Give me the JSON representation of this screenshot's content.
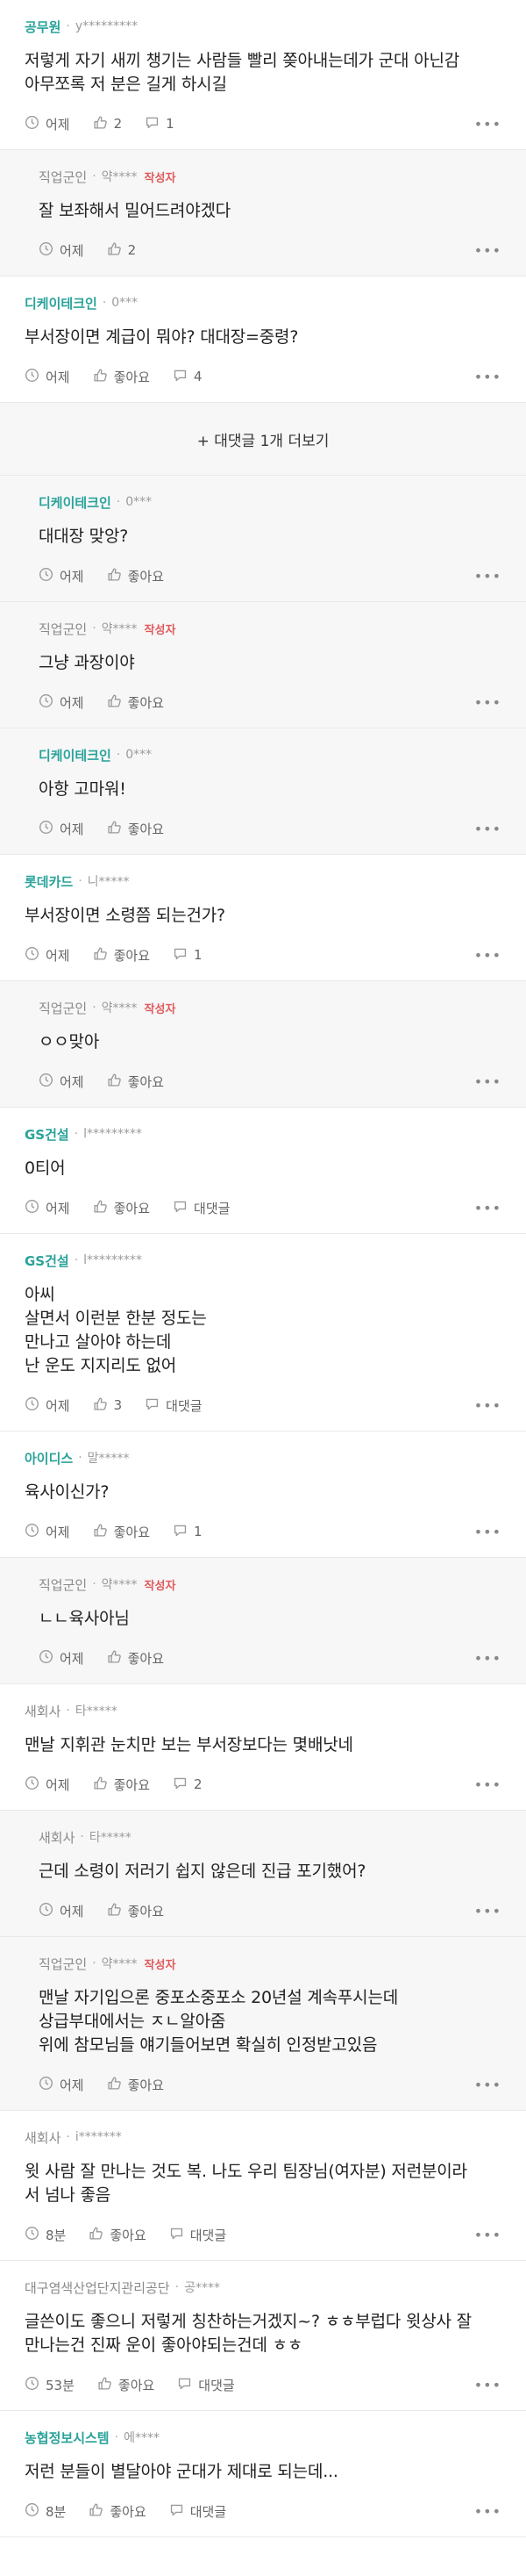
{
  "comments": [
    {
      "id": "c1",
      "reply": false,
      "company": "공무원",
      "company_style": "teal",
      "nick": "y*********",
      "author_badge": "",
      "text": "저렇게 자기 새끼 챙기는 사람들 빨리 쫒아내는데가 군대 아닌감\n아무쪼록 저 분은 길게 하시길",
      "time": "어제",
      "likes": "2",
      "replies": "1"
    },
    {
      "id": "c2",
      "reply": true,
      "company": "직업군인",
      "company_style": "gray",
      "nick": "약****",
      "author_badge": "작성자",
      "text": "잘 보좌해서 밀어드려야겠다",
      "time": "어제",
      "likes": "2",
      "replies": null
    },
    {
      "id": "c3",
      "reply": false,
      "company": "디케이테크인",
      "company_style": "teal",
      "nick": "0***",
      "author_badge": "",
      "text": "부서장이면 계급이 뭐야? 대대장=중령?",
      "time": "어제",
      "likes": "좋아요",
      "replies": "4"
    },
    {
      "id": "more",
      "type": "more",
      "label": "+ 대댓글 1개 더보기"
    },
    {
      "id": "c4",
      "reply": true,
      "company": "디케이테크인",
      "company_style": "teal",
      "nick": "0***",
      "author_badge": "",
      "text": "대대장 맞앙?",
      "time": "어제",
      "likes": "좋아요",
      "replies": null
    },
    {
      "id": "c5",
      "reply": true,
      "company": "직업군인",
      "company_style": "gray",
      "nick": "약****",
      "author_badge": "작성자",
      "text": "그냥 과장이야",
      "time": "어제",
      "likes": "좋아요",
      "replies": null
    },
    {
      "id": "c6",
      "reply": true,
      "company": "디케이테크인",
      "company_style": "teal",
      "nick": "0***",
      "author_badge": "",
      "text": "아항 고마워!",
      "time": "어제",
      "likes": "좋아요",
      "replies": null
    },
    {
      "id": "c7",
      "reply": false,
      "company": "롯데카드",
      "company_style": "teal",
      "nick": "니*****",
      "author_badge": "",
      "text": "부서장이면 소령쯤 되는건가?",
      "time": "어제",
      "likes": "좋아요",
      "replies": "1"
    },
    {
      "id": "c8",
      "reply": true,
      "company": "직업군인",
      "company_style": "gray",
      "nick": "약****",
      "author_badge": "작성자",
      "text": "ㅇㅇ맞아",
      "time": "어제",
      "likes": "좋아요",
      "replies": null
    },
    {
      "id": "c9",
      "reply": false,
      "company": "GS건설",
      "company_style": "teal",
      "nick": "l*********",
      "author_badge": "",
      "text": "0티어",
      "time": "어제",
      "likes": "좋아요",
      "replies": "대댓글"
    },
    {
      "id": "c10",
      "reply": false,
      "company": "GS건설",
      "company_style": "teal",
      "nick": "l*********",
      "author_badge": "",
      "text": "아씨\n살면서 이런분 한분 정도는\n만나고 살아야 하는데\n난 운도 지지리도 없어",
      "time": "어제",
      "likes": "3",
      "replies": "대댓글"
    },
    {
      "id": "c11",
      "reply": false,
      "company": "아이디스",
      "company_style": "teal",
      "nick": "말*****",
      "author_badge": "",
      "text": "육사이신가?",
      "time": "어제",
      "likes": "좋아요",
      "replies": "1"
    },
    {
      "id": "c12",
      "reply": true,
      "company": "직업군인",
      "company_style": "gray",
      "nick": "약****",
      "author_badge": "작성자",
      "text": "ㄴㄴ육사아님",
      "time": "어제",
      "likes": "좋아요",
      "replies": null
    },
    {
      "id": "c13",
      "reply": false,
      "company": "새회사",
      "company_style": "gray",
      "nick": "타*****",
      "author_badge": "",
      "text": "맨날 지휘관 눈치만 보는 부서장보다는 몇배낫네",
      "time": "어제",
      "likes": "좋아요",
      "replies": "2"
    },
    {
      "id": "c14",
      "reply": true,
      "company": "새회사",
      "company_style": "gray",
      "nick": "타*****",
      "author_badge": "",
      "text": "근데 소령이 저러기 쉽지 않은데 진급 포기했어?",
      "time": "어제",
      "likes": "좋아요",
      "replies": null
    },
    {
      "id": "c15",
      "reply": true,
      "company": "직업군인",
      "company_style": "gray",
      "nick": "약****",
      "author_badge": "작성자",
      "text": "맨날 자기입으론 중포소중포소 20년설 계속푸시는데\n상급부대에서는 ㅈㄴ알아줌\n위에 참모님들 얘기들어보면 확실히 인정받고있음",
      "time": "어제",
      "likes": "좋아요",
      "replies": null
    },
    {
      "id": "c16",
      "reply": false,
      "company": "새회사",
      "company_style": "gray",
      "nick": "i*******",
      "author_badge": "",
      "text": "윗 사람 잘 만나는 것도 복. 나도 우리 팀장님(여자분) 저런분이라\n서 넘나 좋음",
      "time": "8분",
      "likes": "좋아요",
      "replies": "대댓글"
    },
    {
      "id": "c17",
      "reply": false,
      "company": "대구염색산업단지관리공단",
      "company_style": "gray",
      "nick": "공****",
      "author_badge": "",
      "text": "글쓴이도 좋으니 저렇게 칭찬하는거겠지~? ㅎㅎ부럽다 윗상사 잘\n만나는건 진짜 운이 좋아야되는건데 ㅎㅎ",
      "time": "53분",
      "likes": "좋아요",
      "replies": "대댓글"
    },
    {
      "id": "c18",
      "reply": false,
      "company": "농협정보시스템",
      "company_style": "teal",
      "nick": "에****",
      "author_badge": "",
      "text": "저런 분들이 별달아야 군대가 제대로 되는데...",
      "time": "8분",
      "likes": "좋아요",
      "replies": "대댓글"
    }
  ]
}
